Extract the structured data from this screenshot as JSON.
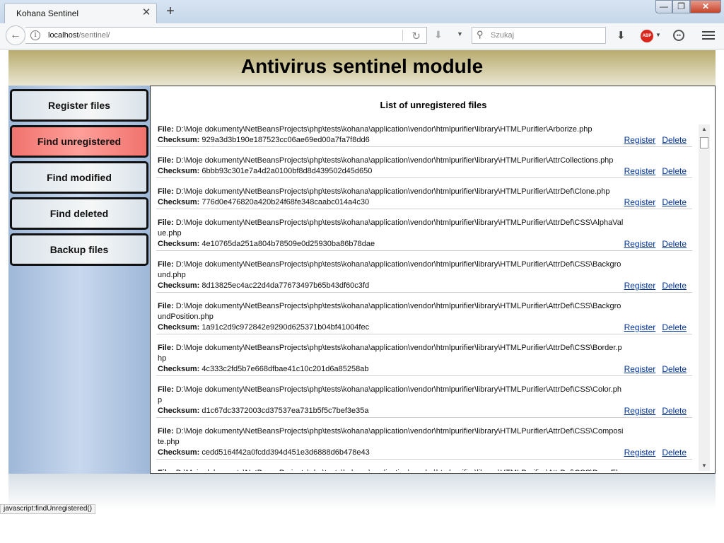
{
  "browser": {
    "tab_title": "Kohana Sentinel",
    "tab_close": "✕",
    "new_tab": "+",
    "url_host": "localhost",
    "url_path": "/sentinel/",
    "search_placeholder": "Szukaj",
    "window_buttons": {
      "minimize": "—",
      "maximize": "❐",
      "close": "✕"
    },
    "abp_label": "ABP"
  },
  "header": {
    "title": "Antivirus sentinel module"
  },
  "sidebar": {
    "items": [
      {
        "label": "Register files",
        "active": false
      },
      {
        "label": "Find unregistered",
        "active": true
      },
      {
        "label": "Find modified",
        "active": false
      },
      {
        "label": "Find deleted",
        "active": false
      },
      {
        "label": "Backup files",
        "active": false
      }
    ]
  },
  "main": {
    "title": "List of unregistered files",
    "file_label": "File:",
    "checksum_label": "Checksum:",
    "register_label": "Register",
    "delete_label": "Delete",
    "entries": [
      {
        "file": "D:\\Moje dokumenty\\NetBeansProjects\\php\\tests\\kohana\\application\\vendor\\htmlpurifier\\library\\HTMLPurifier\\Arborize.php",
        "checksum": "929a3d3b190e187523cc06ae69ed00a7fa7f8dd6"
      },
      {
        "file": "D:\\Moje dokumenty\\NetBeansProjects\\php\\tests\\kohana\\application\\vendor\\htmlpurifier\\library\\HTMLPurifier\\AttrCollections.php",
        "checksum": "6bbb93c301e7a4d2a0100bf8d8d439502d45d650"
      },
      {
        "file": "D:\\Moje dokumenty\\NetBeansProjects\\php\\tests\\kohana\\application\\vendor\\htmlpurifier\\library\\HTMLPurifier\\AttrDef\\Clone.php",
        "checksum": "776d0e476820a420b24f68fe348caabc014a4c30"
      },
      {
        "file": "D:\\Moje dokumenty\\NetBeansProjects\\php\\tests\\kohana\\application\\vendor\\htmlpurifier\\library\\HTMLPurifier\\AttrDef\\CSS\\AlphaValue.php",
        "checksum": "4e10765da251a804b78509e0d25930ba86b78dae"
      },
      {
        "file": "D:\\Moje dokumenty\\NetBeansProjects\\php\\tests\\kohana\\application\\vendor\\htmlpurifier\\library\\HTMLPurifier\\AttrDef\\CSS\\Background.php",
        "checksum": "8d13825ec4ac22d4da77673497b65b43df60c3fd"
      },
      {
        "file": "D:\\Moje dokumenty\\NetBeansProjects\\php\\tests\\kohana\\application\\vendor\\htmlpurifier\\library\\HTMLPurifier\\AttrDef\\CSS\\BackgroundPosition.php",
        "checksum": "1a91c2d9c972842e9290d625371b04bf41004fec"
      },
      {
        "file": "D:\\Moje dokumenty\\NetBeansProjects\\php\\tests\\kohana\\application\\vendor\\htmlpurifier\\library\\HTMLPurifier\\AttrDef\\CSS\\Border.php",
        "checksum": "4c333c2fd5b7e668dfbae41c10c201d6a85258ab"
      },
      {
        "file": "D:\\Moje dokumenty\\NetBeansProjects\\php\\tests\\kohana\\application\\vendor\\htmlpurifier\\library\\HTMLPurifier\\AttrDef\\CSS\\Color.php",
        "checksum": "d1c67dc3372003cd37537ea731b5f5c7bef3e35a"
      },
      {
        "file": "D:\\Moje dokumenty\\NetBeansProjects\\php\\tests\\kohana\\application\\vendor\\htmlpurifier\\library\\HTMLPurifier\\AttrDef\\CSS\\Composite.php",
        "checksum": "cedd5164f42a0fcdd394d451e3d6888d6b478e43"
      },
      {
        "file": "D:\\Moje dokumenty\\NetBeansProjects\\php\\tests\\kohana\\application\\vendor\\htmlpurifier\\library\\HTMLPurifier\\AttrDef\\CSS\\DenyElementDecorator.php",
        "checksum": ""
      }
    ]
  },
  "status": {
    "text": "javascript:findUnregistered()"
  },
  "colors": {
    "active_button": "#ff8a84",
    "header_gold": "#c4b67c",
    "sidebar_blue": "#aec4e2",
    "link": "#00339a"
  },
  "icons": {
    "back": "arrow-left-icon",
    "info": "info-icon",
    "reload": "reload-icon",
    "download": "download-icon",
    "search": "search-icon",
    "abp": "adblock-icon",
    "feedback": "smiley-icon",
    "menu": "hamburger-menu-icon"
  }
}
